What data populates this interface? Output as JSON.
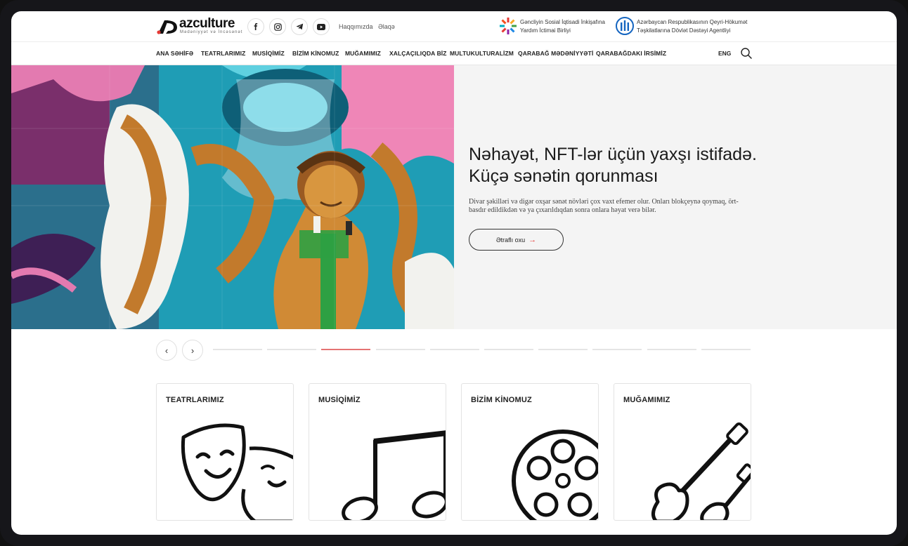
{
  "header": {
    "logo_text": "azculture",
    "logo_subtitle": "Mədəniyyət və İncəsənət",
    "social": [
      {
        "icon": "facebook-icon"
      },
      {
        "icon": "instagram-icon"
      },
      {
        "icon": "telegram-icon"
      },
      {
        "icon": "youtube-icon"
      }
    ],
    "links": [
      "Haqqımızda",
      "Əlaqə"
    ],
    "partners": [
      {
        "line1": "Gəncliyin Sosial İqtisadi İnkişafına",
        "line2": "Yardım İctimai Birliyi"
      },
      {
        "line1": "Azərbaycan Respublikasının Qeyri-Hökumət",
        "line2": "Təşkilatlarına Dövlət Dəstəyi Agentliyi"
      }
    ]
  },
  "nav": {
    "items": [
      "ANA SƏHİFƏ",
      "TEATRLARIMIZ",
      "MUSİQİMİZ",
      "BİZİM KİNOMUZ",
      "MUĞAMIMIZ",
      "XALÇAÇILIQDA BİZ",
      "MULTUKULTURALİZM",
      "QARABAĞ MƏDƏNİYYƏTİ",
      "QARABAĞDAKI İRSİMİZ"
    ],
    "lang": "ENG"
  },
  "hero": {
    "title": "Nəhayət, NFT-lər üçün yaxşı istifadə. Küçə sənətin qorunması",
    "description": "Divar şəkilləri və digər oxşar sənət növləri çox vaxt efemer olur. Onları blokçeynə qoymaq, ört-basdır edildikdən və ya çıxarıldıqdan sonra onlara həyat verə bilər.",
    "button_label": "Ətraflı oxu",
    "button_arrow": "→"
  },
  "slider": {
    "prev": "‹",
    "next": "›",
    "total": 10,
    "active_index": 2
  },
  "cards": [
    {
      "title": "TEATRLARIMIZ",
      "icon": "theater-masks-icon"
    },
    {
      "title": "MUSİQİMİZ",
      "icon": "music-notes-icon"
    },
    {
      "title": "BİZİM KİNOMUZ",
      "icon": "film-reel-icon"
    },
    {
      "title": "MUĞAMIMIZ",
      "icon": "tar-instrument-icon"
    }
  ],
  "colors": {
    "accent": "#e53935",
    "active_dot": "#e57373"
  }
}
